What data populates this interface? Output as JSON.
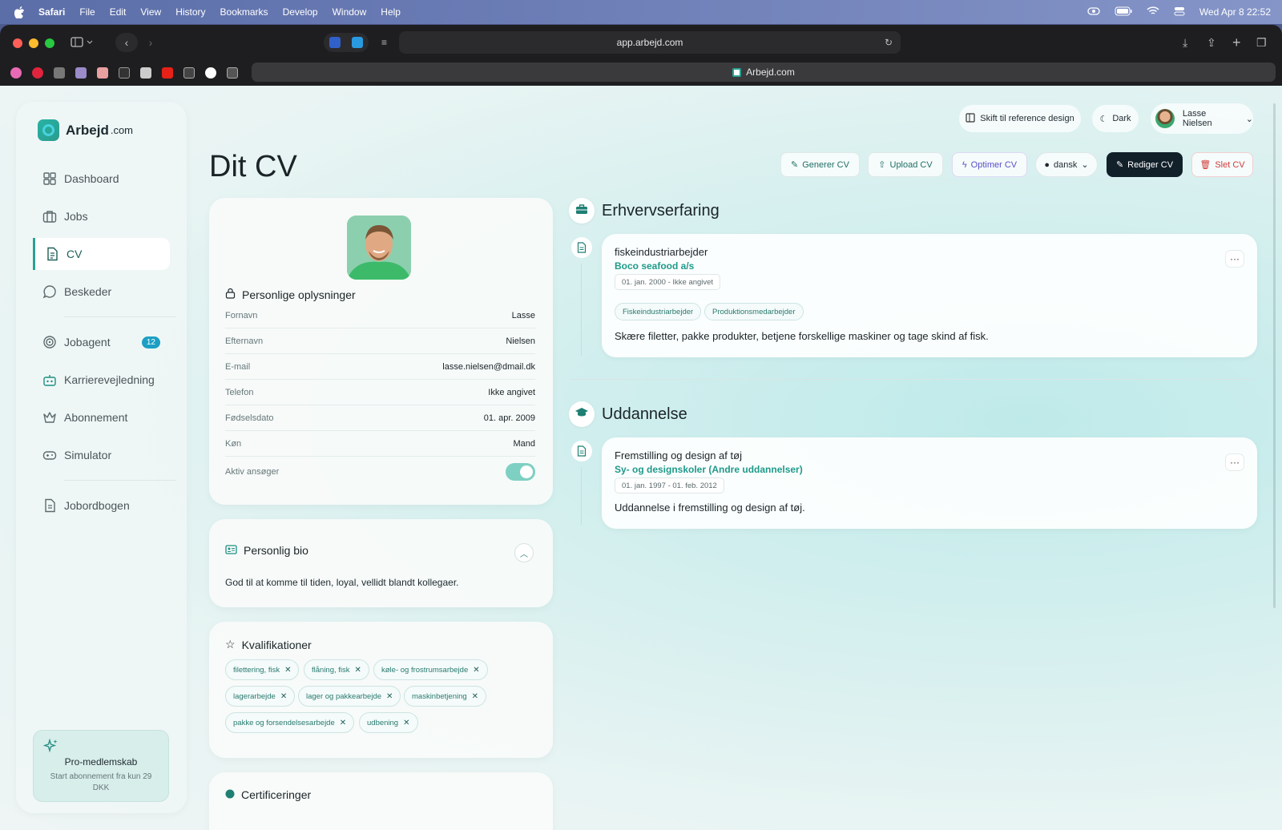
{
  "menubar": {
    "app": "Safari",
    "items": [
      "File",
      "Edit",
      "View",
      "History",
      "Bookmarks",
      "Develop",
      "Window",
      "Help"
    ],
    "datetime": "Wed Apr 8  22:52"
  },
  "browser": {
    "url": "app.arbejd.com",
    "tab_title": "Arbejd.com"
  },
  "brand": {
    "name": "Arbejd",
    "tld": ".com",
    "accent": "#2aa192"
  },
  "nav": {
    "dashboard": "Dashboard",
    "jobs": "Jobs",
    "cv": "CV",
    "beskeder": "Beskeder",
    "jobagent": "Jobagent",
    "jobagent_badge": "12",
    "karriere": "Karrierevejledning",
    "abonnement": "Abonnement",
    "simulator": "Simulator",
    "jobordbogen": "Jobordbogen"
  },
  "pro": {
    "title": "Pro-medlemskab",
    "subtitle": "Start abonnement fra kun 29 DKK"
  },
  "top": {
    "switch": "Skift til reference design",
    "theme": "Dark",
    "user": "Lasse Nielsen"
  },
  "page": {
    "title": "Dit CV"
  },
  "actions": {
    "generate": "Generer CV",
    "upload": "Upload CV",
    "optimize": "Optimer CV",
    "language": "dansk",
    "edit": "Rediger CV",
    "delete": "Slet CV"
  },
  "personal": {
    "title": "Personlige oplysninger",
    "rows": [
      {
        "label": "Fornavn",
        "value": "Lasse"
      },
      {
        "label": "Efternavn",
        "value": "Nielsen"
      },
      {
        "label": "E-mail",
        "value": "lasse.nielsen@dmail.dk"
      },
      {
        "label": "Telefon",
        "value": "Ikke angivet"
      },
      {
        "label": "Fødselsdato",
        "value": "01. apr. 2009"
      },
      {
        "label": "Køn",
        "value": "Mand"
      }
    ],
    "active_label": "Aktiv ansøger",
    "active": true
  },
  "bio": {
    "title": "Personlig bio",
    "text": "God til at komme til tiden, loyal, vellidt blandt kollegaer."
  },
  "qualifications": {
    "title": "Kvalifikationer",
    "chips": [
      "filettering, fisk",
      "flåning, fisk",
      "køle- og frostrumsarbejde",
      "lagerarbejde",
      "lager og pakkearbejde",
      "maskinbetjening",
      "pakke og forsendelsesarbejde",
      "udbening"
    ]
  },
  "certs": {
    "title": "Certificeringer"
  },
  "experience": {
    "title": "Erhvervserfaring",
    "items": [
      {
        "title": "fiskeindustriarbejder",
        "company": "Boco seafood a/s",
        "dates": "01. jan. 2000 - Ikke angivet",
        "tags": [
          "Fiskeindustriarbejder",
          "Produktionsmedarbejder"
        ],
        "description": "Skære filetter, pakke produkter, betjene forskellige maskiner og tage skind af fisk."
      }
    ]
  },
  "education": {
    "title": "Uddannelse",
    "items": [
      {
        "title": "Fremstilling og design af tøj",
        "school": "Sy- og designskoler (Andre uddannelser)",
        "dates": "01. jan. 1997 - 01. feb. 2012",
        "description": "Uddannelse i fremstilling og design af tøj."
      }
    ]
  }
}
